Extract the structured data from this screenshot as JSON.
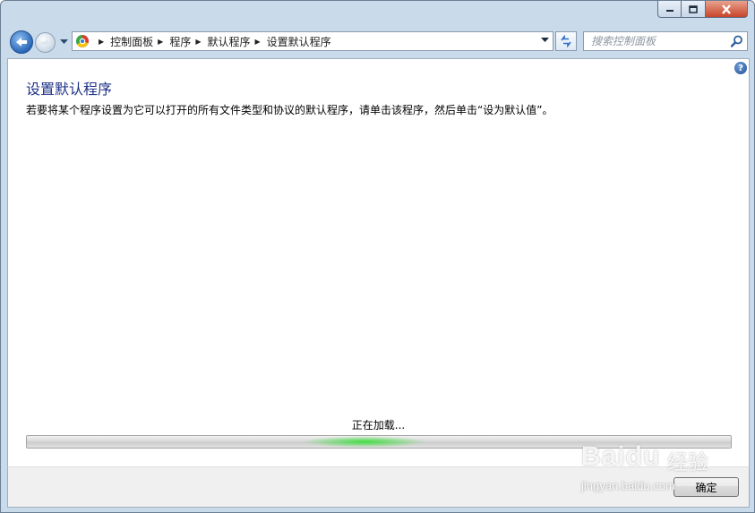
{
  "window": {
    "controls": [
      "minimize",
      "maximize",
      "close"
    ]
  },
  "nav": {
    "breadcrumb": [
      "控制面板",
      "程序",
      "默认程序",
      "设置默认程序"
    ],
    "search_placeholder": "搜索控制面板"
  },
  "page": {
    "title": "设置默认程序",
    "description": "若要将某个程序设置为它可以打开的所有文件类型和协议的默认程序，请单击该程序，然后单击“设为默认值”。",
    "loading_text": "正在加载...",
    "progress_glow_center": 0.48
  },
  "footer": {
    "ok_label": "确定"
  },
  "watermark": {
    "brand": "Baidu",
    "service": "经验",
    "url": "jingyan.baidu.com"
  },
  "colors": {
    "title_text": "#1e3287",
    "progress_glow": "#3fe03f",
    "frame": "#c9daea"
  }
}
